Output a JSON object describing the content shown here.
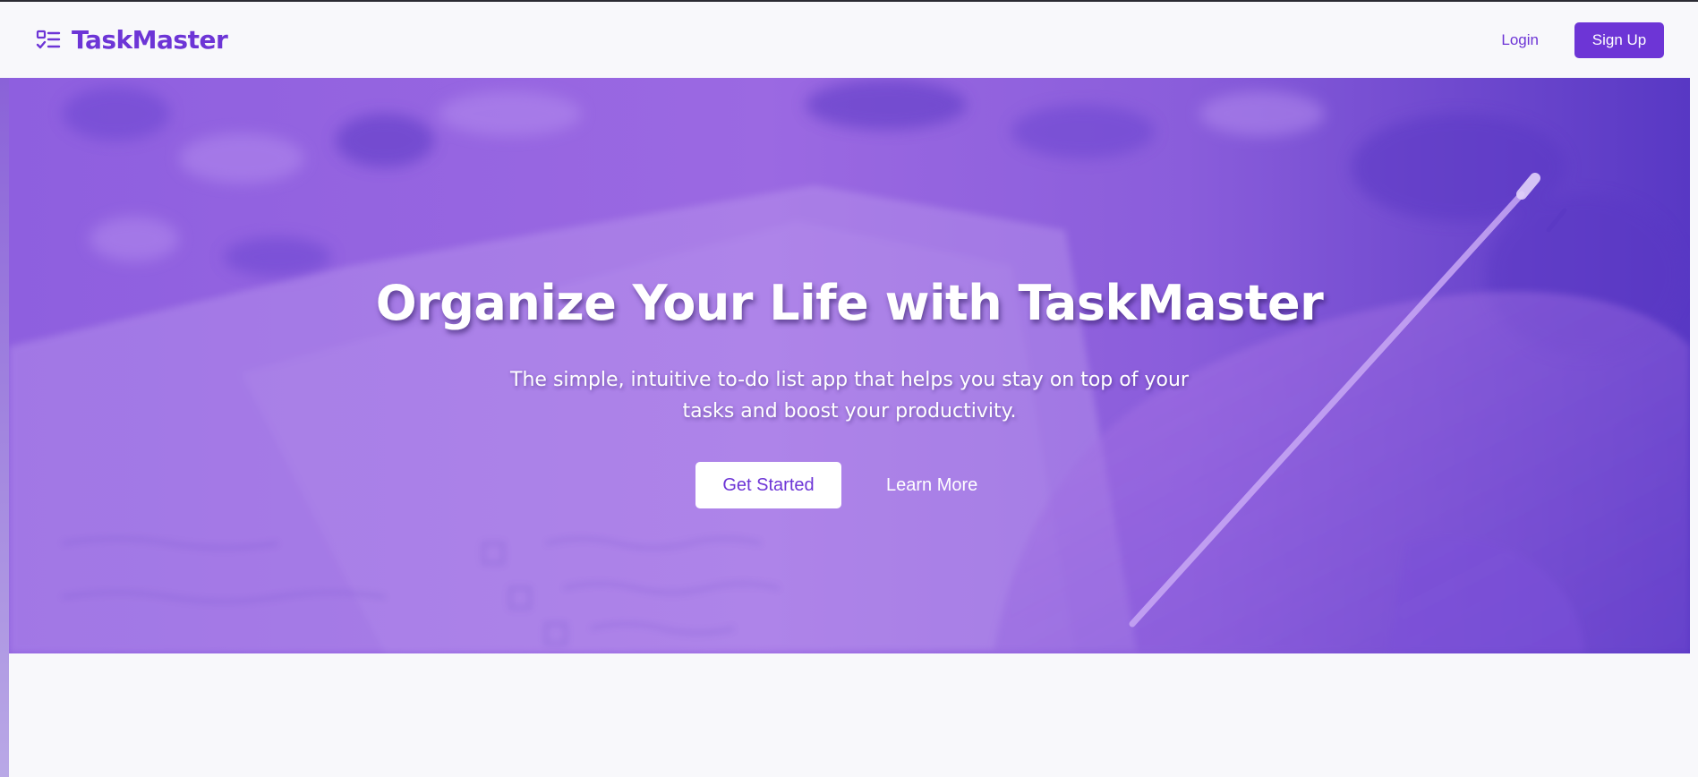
{
  "colors": {
    "brand": "#6d35d6",
    "hero_overlay": "#8e5fdf",
    "page_background": "#f8f8fb"
  },
  "navbar": {
    "logo_icon": "task-list-icon",
    "brand_name": "TaskMaster",
    "login_label": "Login",
    "signup_label": "Sign Up"
  },
  "hero": {
    "background_image": "notebook-writing-photo",
    "title": "Organize Your Life with TaskMaster",
    "subtitle": "The simple, intuitive to-do list app that helps you stay on top of your tasks and boost your productivity.",
    "primary_cta": "Get Started",
    "secondary_cta": "Learn More"
  }
}
